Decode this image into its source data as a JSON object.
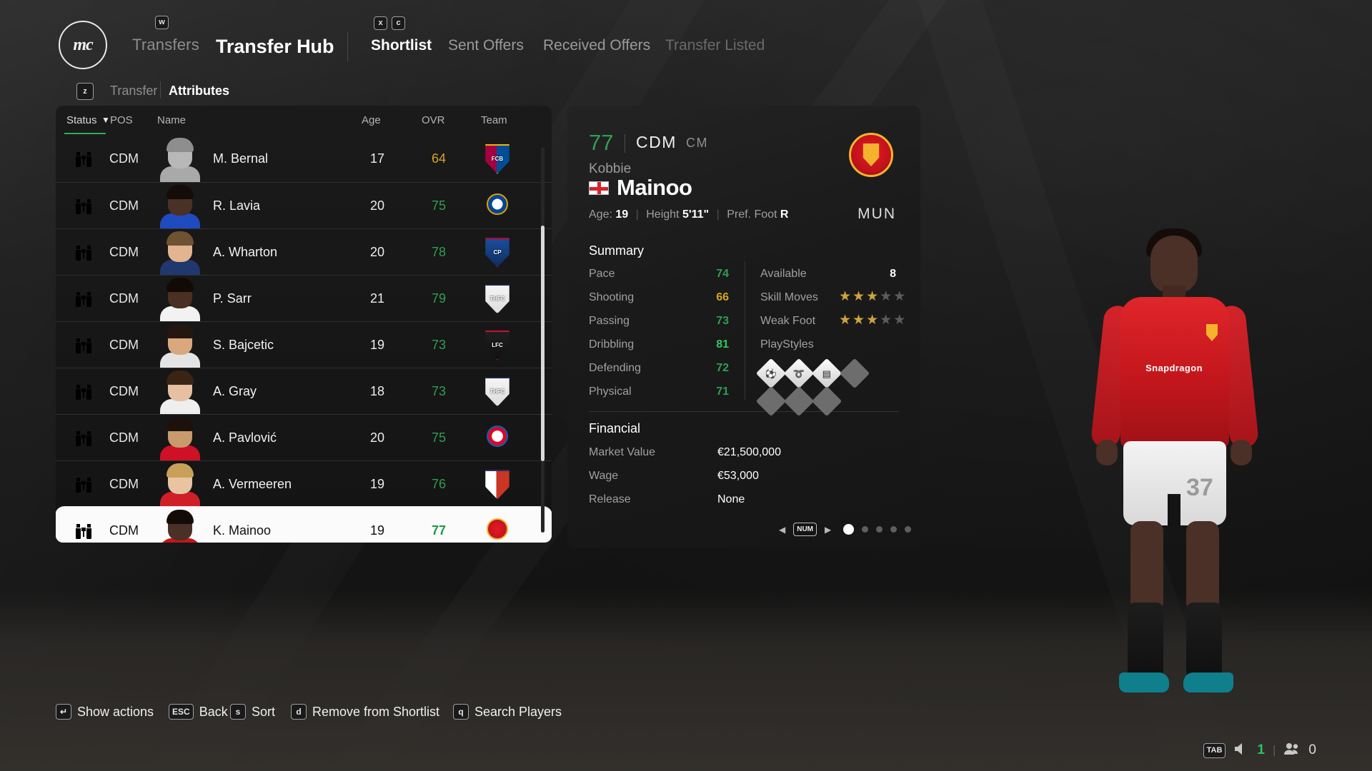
{
  "header": {
    "logo_text": "mc",
    "key_w": "w",
    "nav_transfers": "Transfers",
    "title": "Transfer Hub",
    "key_x": "x",
    "key_c": "c",
    "tabs": [
      {
        "label": "Shortlist",
        "active": true
      },
      {
        "label": "Sent Offers",
        "active": false
      },
      {
        "label": "Received Offers",
        "active": false
      },
      {
        "label": "Transfer Listed",
        "active": false
      }
    ],
    "key_z": "z",
    "subtabs": [
      {
        "label": "Transfer",
        "active": false
      },
      {
        "label": "Attributes",
        "active": true
      }
    ]
  },
  "table": {
    "columns": [
      "Status",
      "POS",
      "Name",
      "Age",
      "OVR",
      "Team"
    ],
    "sort_caret": "▼",
    "rows": [
      {
        "pos": "CDM",
        "name": "M. Bernal",
        "age": "17",
        "ovr": "64",
        "ovr_tone": "gold",
        "team": "FC Barcelona",
        "skin": "#b8b8b8",
        "hair": "#8e8e8e",
        "kit": "#a9a9a9",
        "crest": {
          "type": "shield",
          "bg": "linear-gradient(90deg,#a50044 0%,#a50044 48%,#004d98 48%,#004d98 100%)",
          "text": "FCB",
          "border": "#f0b500"
        }
      },
      {
        "pos": "CDM",
        "name": "R. Lavia",
        "age": "20",
        "ovr": "75",
        "ovr_tone": "green",
        "team": "Chelsea",
        "skin": "#4a3126",
        "hair": "#140c08",
        "kit": "#1f4bbf",
        "crest": {
          "type": "circle",
          "bg": "radial-gradient(circle,#ffffff 0%,#ffffff 40%,#034694 41%,#034694 100%)",
          "text": "",
          "border": "#d8a300"
        }
      },
      {
        "pos": "CDM",
        "name": "A. Wharton",
        "age": "20",
        "ovr": "78",
        "ovr_tone": "green",
        "team": "Crystal Palace",
        "skin": "#e2b48f",
        "hair": "#6e5233",
        "kit": "#20386e",
        "crest": {
          "type": "shield",
          "bg": "linear-gradient(180deg,#1b4f9c 0%,#0d2c5e 100%)",
          "text": "CP",
          "border": "#c3002f"
        }
      },
      {
        "pos": "CDM",
        "name": "P. Sarr",
        "age": "21",
        "ovr": "79",
        "ovr_tone": "green",
        "team": "Tottenham Hotspur",
        "skin": "#4a2f22",
        "hair": "#110a06",
        "kit": "#f2f2f2",
        "crest": {
          "type": "shield",
          "bg": "linear-gradient(180deg,#f6f6f6 0%,#dcdcdc 100%)",
          "text": "THFC",
          "border": "#13264b"
        }
      },
      {
        "pos": "CDM",
        "name": "S. Bajcetic",
        "age": "19",
        "ovr": "73",
        "ovr_tone": "green",
        "team": "Liverpool",
        "skin": "#d9a87d",
        "hair": "#241610",
        "kit": "#e4e4e4",
        "crest": {
          "type": "shield",
          "bg": "linear-gradient(180deg,#1f1f1f 0%,#111111 100%)",
          "text": "LFC",
          "border": "#c8102e"
        }
      },
      {
        "pos": "CDM",
        "name": "A. Gray",
        "age": "18",
        "ovr": "73",
        "ovr_tone": "green",
        "team": "Tottenham Hotspur",
        "skin": "#e6c0a0",
        "hair": "#3a2416",
        "kit": "#efefef",
        "crest": {
          "type": "shield",
          "bg": "linear-gradient(180deg,#f6f6f6 0%,#dcdcdc 100%)",
          "text": "THFC",
          "border": "#13264b"
        }
      },
      {
        "pos": "CDM",
        "name": "A. Pavlović",
        "age": "20",
        "ovr": "75",
        "ovr_tone": "green",
        "team": "Bayern München",
        "skin": "#c99a6e",
        "hair": "#1d120b",
        "kit": "#cf1126",
        "crest": {
          "type": "circle",
          "bg": "radial-gradient(circle,#ffffff 0%,#ffffff 42%,#dc052d 43%,#dc052d 100%)",
          "text": "",
          "border": "#0066b2"
        }
      },
      {
        "pos": "CDM",
        "name": "A. Vermeeren",
        "age": "19",
        "ovr": "76",
        "ovr_tone": "green",
        "team": "Atlético Madrid",
        "skin": "#e8c4a2",
        "hair": "#c9a05a",
        "kit": "#cf2028",
        "crest": {
          "type": "shield",
          "bg": "linear-gradient(90deg,#ffffff 0%,#ffffff 46%,#cb3524 46%,#cb3524 100%)",
          "text": "",
          "border": "#272e61"
        }
      },
      {
        "pos": "CDM",
        "name": "K. Mainoo",
        "age": "19",
        "ovr": "77",
        "ovr_tone": "green",
        "team": "Manchester United",
        "skin": "#4a3026",
        "hair": "#120b07",
        "kit": "#c2161c",
        "crest": {
          "type": "circle",
          "bg": "radial-gradient(circle,#e31b23 0%,#b8101a 100%)",
          "text": "",
          "border": "#f5b32d"
        },
        "selected": true
      }
    ]
  },
  "detail": {
    "ovr": "77",
    "position": "CDM",
    "alt_position": "CM",
    "first_name": "Kobbie",
    "last_name": "Mainoo",
    "nation_flag": "england-flag",
    "age_label": "Age:",
    "age_value": "19",
    "height_label": "Height",
    "height_value": "5'11\"",
    "foot_label": "Pref. Foot",
    "foot_value": "R",
    "club_abbrev": "MUN",
    "club_crest": "manchester-united-crest",
    "summary_title": "Summary",
    "attributes": [
      {
        "label": "Pace",
        "value": "74",
        "tone": "g"
      },
      {
        "label": "Shooting",
        "value": "66",
        "tone": "y"
      },
      {
        "label": "Passing",
        "value": "73",
        "tone": "g"
      },
      {
        "label": "Dribbling",
        "value": "81",
        "tone": "gb"
      },
      {
        "label": "Defending",
        "value": "72",
        "tone": "g"
      },
      {
        "label": "Physical",
        "value": "71",
        "tone": "g"
      }
    ],
    "available_label": "Available",
    "available_value": "8",
    "skill_moves_label": "Skill Moves",
    "skill_moves": 3,
    "weak_foot_label": "Weak Foot",
    "weak_foot": 3,
    "star_max": 5,
    "playstyles_label": "PlayStyles",
    "playstyles": [
      {
        "icon": "press-proven-icon",
        "glyph": "⚽",
        "active": true
      },
      {
        "icon": "whipped-pass-icon",
        "glyph": "➰",
        "active": true
      },
      {
        "icon": "block-icon",
        "glyph": "▤",
        "active": true
      },
      {
        "icon": "empty-slot-icon",
        "glyph": "",
        "active": false
      },
      {
        "icon": "empty-slot-icon",
        "glyph": "",
        "active": false
      },
      {
        "icon": "empty-slot-icon",
        "glyph": "",
        "active": false
      },
      {
        "icon": "empty-slot-icon",
        "glyph": "",
        "active": false
      }
    ],
    "financial_title": "Financial",
    "financial": [
      {
        "label": "Market Value",
        "value": "€21,500,000"
      },
      {
        "label": "Wage",
        "value": "€53,000"
      },
      {
        "label": "Release",
        "value": "None"
      }
    ],
    "pager": {
      "prev": "◀",
      "key": "NUM",
      "next": "▶",
      "dots": 5,
      "active_index": 0
    }
  },
  "player_render": {
    "shirt_number": "37",
    "sponsor": "Snapdragon"
  },
  "actions": [
    {
      "key": "↵",
      "label": "Show actions"
    },
    {
      "key": "ESC",
      "label": "Back"
    },
    {
      "key": "s",
      "label": "Sort"
    },
    {
      "key": "d",
      "label": "Remove from Shortlist"
    },
    {
      "key": "q",
      "label": "Search Players"
    }
  ],
  "hud": {
    "key_tab": "TAB",
    "volume_icon": "speaker-icon",
    "volume_value": "1",
    "players_icon": "people-icon",
    "players_value": "0"
  },
  "colors": {
    "accent_green": "#2f9e52",
    "bright_green": "#31c75e",
    "gold": "#d3a521",
    "selected_row_bg": "#fbfbfb"
  }
}
